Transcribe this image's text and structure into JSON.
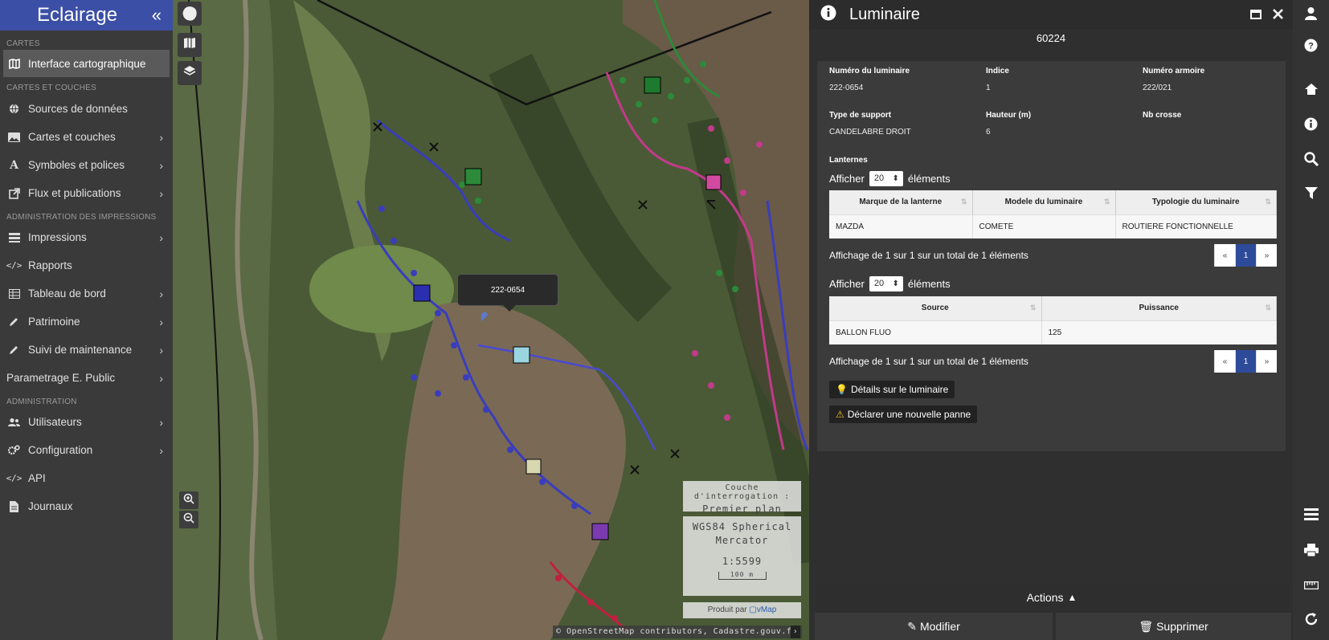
{
  "sidebar": {
    "brand": "Eclairage",
    "collapse_icon": "«",
    "sections": {
      "cartes": "Cartes",
      "cartes_couches": "Cartes et couches",
      "admin_impressions": "Administration des impressions",
      "administration": "Administration"
    },
    "items": {
      "interface": "Interface cartographique",
      "sources": "Sources de données",
      "cartes_couches": "Cartes et couches",
      "symboles": "Symboles et polices",
      "flux": "Flux et publications",
      "impressions": "Impressions",
      "rapports": "Rapports",
      "tableau": "Tableau de bord",
      "patrimoine": "Patrimoine",
      "suivi": "Suivi de maintenance",
      "parametrage": "Parametrage E. Public",
      "utilisateurs": "Utilisateurs",
      "configuration": "Configuration",
      "api": "API",
      "journaux": "Journaux"
    }
  },
  "map": {
    "tooltip": "222-0654",
    "query_layer_label": "Couche d'interrogation :",
    "query_layer_value": "Premier plan",
    "projection_line1": "WGS84 Spherical",
    "projection_line2": "Mercator",
    "scale": "1:5599",
    "scalebar": "100 m",
    "produced_by": "Produit par",
    "vmap": "vMap",
    "attribution": "© OpenStreetMap contributors, Cadastre.gouv.fr"
  },
  "panel": {
    "title": "Luminaire",
    "feature_id": "60224",
    "fields": {
      "numero_label": "Numéro du luminaire",
      "numero_value": "222-0654",
      "indice_label": "Indice",
      "indice_value": "1",
      "armoire_label": "Numéro armoire",
      "armoire_value": "222/021",
      "support_label": "Type de support",
      "support_value": "CANDELABRE DROIT",
      "hauteur_label": "Hauteur (m)",
      "hauteur_value": "6",
      "crosse_label": "Nb crosse"
    },
    "lanternes_label": "Lanternes",
    "afficher": "Afficher",
    "elements": "éléments",
    "page_size": "20",
    "table1": {
      "headers": [
        "Marque de la lanterne",
        "Modele du luminaire",
        "Typologie du luminaire"
      ],
      "rows": [
        [
          "MAZDA",
          "COMETE",
          "ROUTIERE FONCTIONNELLE"
        ]
      ]
    },
    "table2": {
      "headers": [
        "Source",
        "Puissance"
      ],
      "rows": [
        [
          "BALLON FLUO",
          "125"
        ]
      ]
    },
    "pagination_info": "Affichage de 1 sur 1 sur un total de 1 éléments",
    "pager": {
      "prev": "«",
      "page": "1",
      "next": "»"
    },
    "details_btn": "Détails sur le luminaire",
    "panne_btn": "Déclarer une nouvelle panne",
    "actions": "Actions",
    "modifier": "Modifier",
    "supprimer": "Supprimer"
  },
  "colors": {
    "brand_blue": "#3c4fa6",
    "pager_active": "#2e4b9a",
    "warning_yellow": "#f3c431"
  }
}
